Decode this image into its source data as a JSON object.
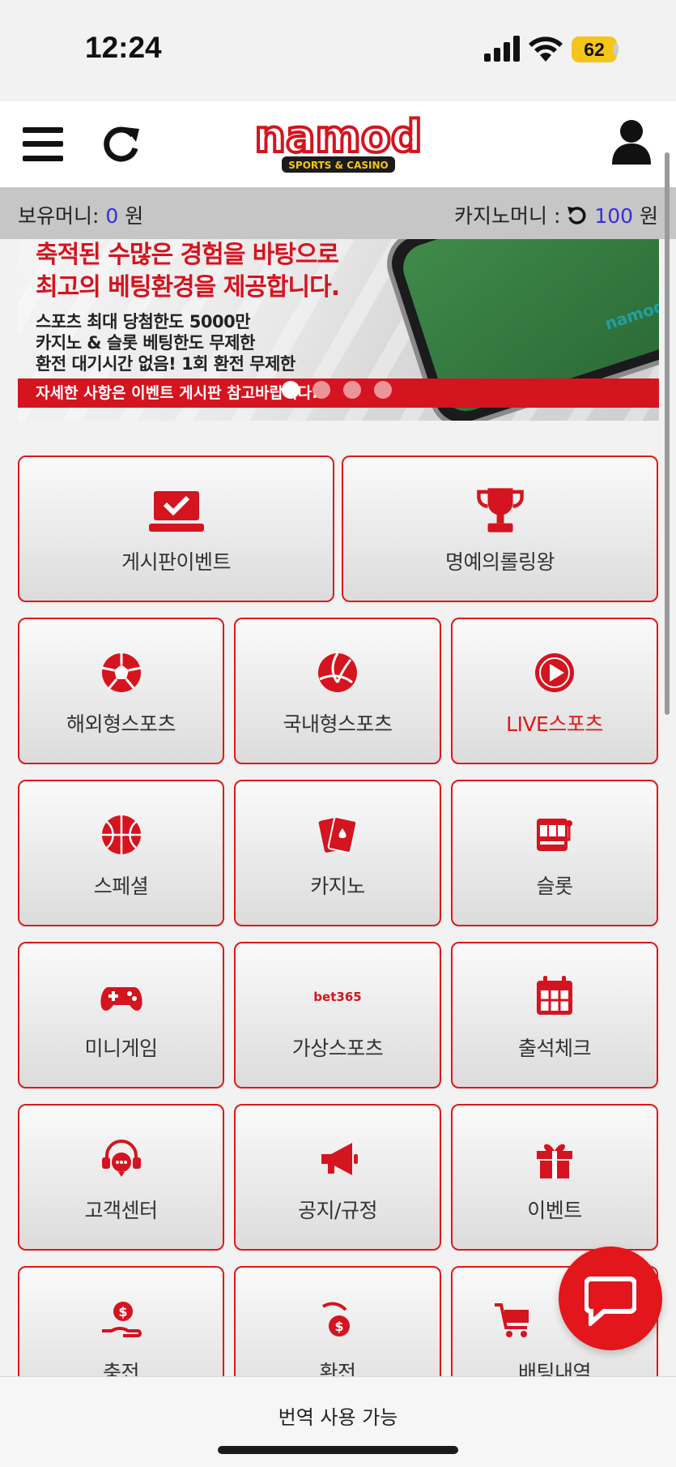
{
  "status_bar": {
    "time": "12:24",
    "battery": "62"
  },
  "header": {
    "logo_text": "namod",
    "logo_sub": "SPORTS & CASINO"
  },
  "balance": {
    "money_label": "보유머니:",
    "money_value": "0",
    "money_unit": "원",
    "casino_label": "카지노머니 :",
    "casino_value": "100",
    "casino_unit": "원"
  },
  "banner": {
    "headline1": "축적된 수많은 경험을 바탕으로",
    "headline2": "최고의 베팅환경을 제공합니다.",
    "line1": "스포츠 최대 당첨한도 5000만",
    "line2": "카지노 & 슬롯 베팅한도 무제한",
    "line3": "환전 대기시간 없음! 1회 환전 무제한",
    "footer": "자세한 사항은 이벤트 게시판 참고바랍니다.",
    "phone_logo": "namod",
    "slides": 4,
    "active_slide": 1
  },
  "menu": {
    "board_event": "게시판이벤트",
    "hall_of_fame": "명예의롤링왕",
    "overseas_sports": "해외형스포츠",
    "domestic_sports": "국내형스포츠",
    "live_sports": "LIVE스포츠",
    "special": "스페셜",
    "casino": "카지노",
    "slot": "슬롯",
    "minigame": "미니게임",
    "virtual_sports": "가상스포츠",
    "virtual_icon": "bet365",
    "attendance": "출석체크",
    "customer_center": "고객센터",
    "notice": "공지/규정",
    "event": "이벤트",
    "deposit": "충전",
    "withdraw": "환전",
    "bet_history": "배팅내역"
  },
  "translate": {
    "label": "번역 사용 가능"
  },
  "colors": {
    "accent": "#e01818",
    "balance_number": "#3a2bdc",
    "balance_bar": "#c6c6c6",
    "battery": "#f5c518"
  }
}
